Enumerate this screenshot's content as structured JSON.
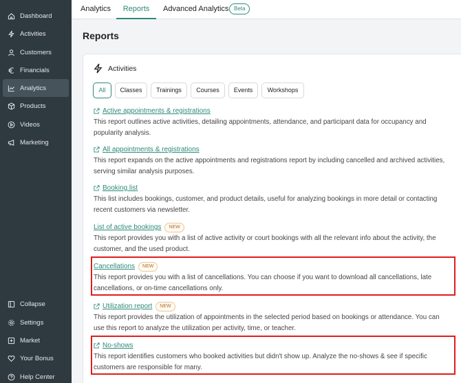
{
  "sidebar": {
    "items": [
      {
        "label": "Dashboard",
        "icon": "home-icon"
      },
      {
        "label": "Activities",
        "icon": "lightning-icon"
      },
      {
        "label": "Customers",
        "icon": "user-icon"
      },
      {
        "label": "Financials",
        "icon": "euro-icon"
      },
      {
        "label": "Analytics",
        "icon": "chart-icon",
        "active": true
      },
      {
        "label": "Products",
        "icon": "box-icon"
      },
      {
        "label": "Videos",
        "icon": "play-icon"
      },
      {
        "label": "Marketing",
        "icon": "megaphone-icon"
      }
    ],
    "bottom": [
      {
        "label": "Collapse",
        "icon": "collapse-icon"
      },
      {
        "label": "Settings",
        "icon": "gear-icon"
      },
      {
        "label": "Market",
        "icon": "plus-square-icon"
      },
      {
        "label": "Your Bonus",
        "icon": "heart-icon"
      },
      {
        "label": "Help Center",
        "icon": "help-icon"
      }
    ]
  },
  "tabs": {
    "analytics": "Analytics",
    "reports": "Reports",
    "advanced": "Advanced Analytics",
    "beta": "Beta"
  },
  "page_title": "Reports",
  "section": {
    "title": "Activities",
    "filters": [
      "All",
      "Classes",
      "Trainings",
      "Courses",
      "Events",
      "Workshops"
    ],
    "active_filter": "All"
  },
  "reports": [
    {
      "title": "Active appointments & registrations",
      "external": true,
      "new": false,
      "desc": "This report outlines active activities, detailing appointments, attendance, and participant data for occupancy and popularity analysis."
    },
    {
      "title": "All appointments & registrations",
      "external": true,
      "new": false,
      "desc": "This report expands on the active appointments and registrations report by including cancelled and archived activities, serving similar analysis purposes."
    },
    {
      "title": "Booking list",
      "external": true,
      "new": false,
      "desc": "This list includes bookings, customer, and product details, useful for analyzing bookings in more detail or contacting recent customers via newsletter."
    },
    {
      "title": "List of active bookings",
      "external": false,
      "new": true,
      "desc": "This report provides you with a list of active activity or court bookings with all the relevant info about the activity, the customer, and the used product."
    },
    {
      "title": "Cancellations",
      "external": false,
      "new": true,
      "desc": "This report provides you with a list of cancellations. You can choose if you want to download all cancellations, late cancellations, or on-time cancellations only."
    },
    {
      "title": "Utilization report",
      "external": true,
      "new": true,
      "desc": "This report provides the utilization of appointments in the selected period based on bookings or attendance. You can use this report to analyze the utilization per activity, time, or teacher."
    },
    {
      "title": "No-shows",
      "external": true,
      "new": false,
      "desc": "This report identifies customers who booked activities but didn't show up. Analyze the no-shows & see if specific customers are responsible for many."
    }
  ],
  "new_badge": "NEW",
  "colors": {
    "sidebar_bg": "#2e3940",
    "accent": "#2c8a78",
    "highlight": "#e11b1b",
    "new_badge": "#b36d1e"
  }
}
